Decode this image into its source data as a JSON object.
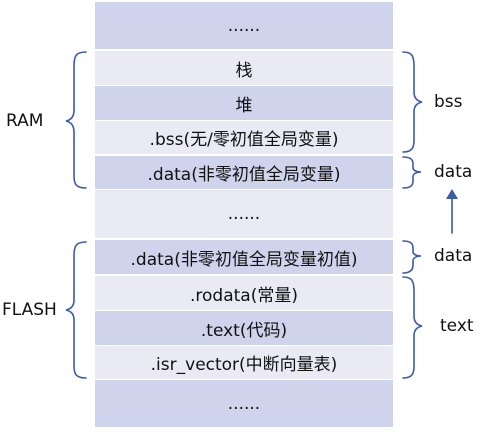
{
  "memory": {
    "rows": [
      "......",
      "栈",
      "堆",
      ".bss(无/零初值全局变量)",
      ".data(非零初值全局变量)",
      "......",
      ".data(非零初值全局变量初值)",
      ".rodata(常量)",
      ".text(代码)",
      ".isr_vector(中断向量表)",
      "......"
    ]
  },
  "left_labels": {
    "ram": "RAM",
    "flash": "FLASH"
  },
  "right_labels": {
    "bss": "bss",
    "data_ram": "data",
    "data_flash": "data",
    "text": "text"
  },
  "colors": {
    "block_dark": "#cfd3eb",
    "block_light": "#e9eaf4",
    "bracket": "#3a5ca8"
  }
}
